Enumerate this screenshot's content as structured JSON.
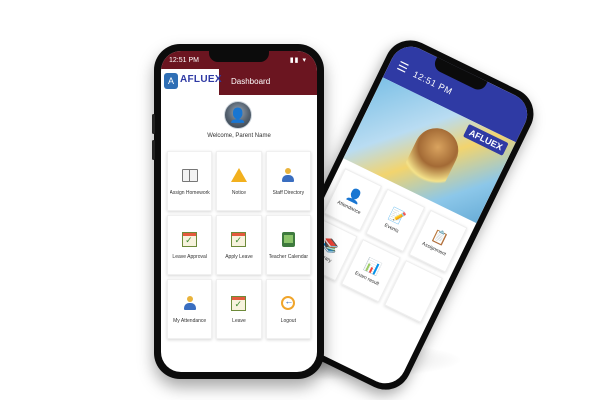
{
  "front_phone": {
    "status_bar": {
      "time": "12:51 PM",
      "icons": "▮▮ ▾"
    },
    "logo": {
      "mark": "A",
      "name": "AFLUEX",
      "tagline": ""
    },
    "title": "Dashboard",
    "profile": {
      "avatar_glyph": "👤",
      "welcome_text": "Welcome, Parent Name"
    },
    "tiles": [
      {
        "label": "Assign Homework",
        "icon": "book-icon"
      },
      {
        "label": "Notice",
        "icon": "warning-icon"
      },
      {
        "label": "Staff Directory",
        "icon": "person-icon"
      },
      {
        "label": "Leave Approval",
        "icon": "calendar-check-icon"
      },
      {
        "label": "Apply Leave",
        "icon": "calendar-check-icon"
      },
      {
        "label": "Teacher Calendar",
        "icon": "tablet-icon"
      },
      {
        "label": "My Attendance",
        "icon": "person-check-icon"
      },
      {
        "label": "Leave",
        "icon": "calendar-check-icon"
      },
      {
        "label": "Logout",
        "icon": "logout-icon"
      }
    ]
  },
  "back_phone": {
    "header": {
      "menu_glyph": "☰",
      "status": "12:51 PM"
    },
    "logo": "AFLUEX",
    "tiles": [
      {
        "label": "Attendance",
        "glyph": "👤"
      },
      {
        "label": "Events",
        "glyph": "📝"
      },
      {
        "label": "Assignment",
        "glyph": "📋"
      },
      {
        "label": "Library",
        "glyph": "📚"
      },
      {
        "label": "Exam result",
        "glyph": "📊"
      },
      {
        "label": "",
        "glyph": ""
      }
    ]
  },
  "colors": {
    "front_header": "#6b1520",
    "back_header": "#2f3aa4",
    "logo_blue": "#2f6fb5"
  }
}
